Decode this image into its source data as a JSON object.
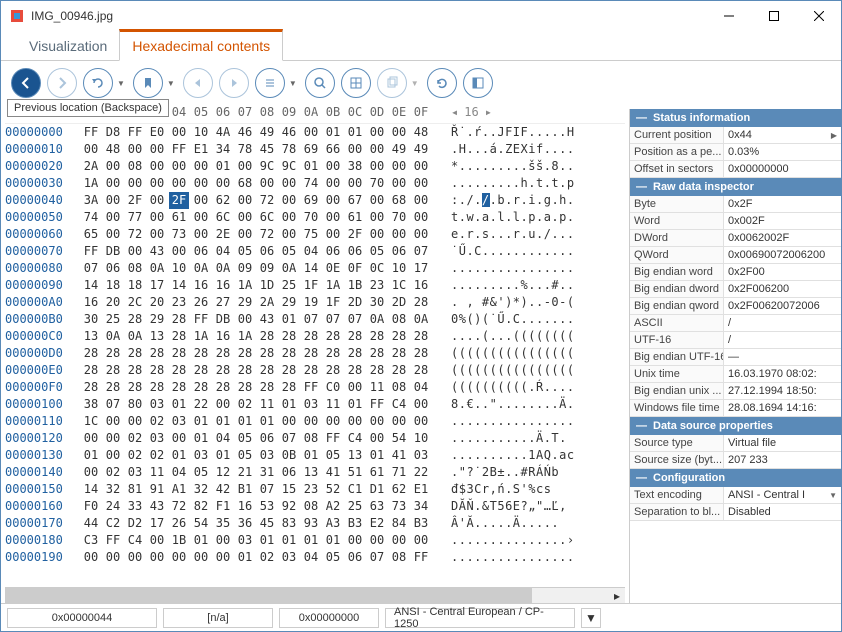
{
  "window": {
    "title": "IMG_00946.jpg"
  },
  "tabs": [
    {
      "label": "Visualization",
      "active": false
    },
    {
      "label": "Hexadecimal contents",
      "active": true
    }
  ],
  "toolbar": {
    "tooltip": "Previous location (Backspace)",
    "page_current": "16"
  },
  "hex": {
    "columns": [
      "00",
      "01",
      "02",
      "03",
      "04",
      "05",
      "06",
      "07",
      "08",
      "09",
      "0A",
      "0B",
      "0C",
      "0D",
      "0E",
      "0F"
    ],
    "highlight": {
      "row": 4,
      "col": 4
    },
    "rows": [
      {
        "offset": "00000000",
        "bytes": [
          "FF",
          "D8",
          "FF",
          "E0",
          "00",
          "10",
          "4A",
          "46",
          "49",
          "46",
          "00",
          "01",
          "01",
          "00",
          "00",
          "48"
        ],
        "ascii": "Ř˙.ŕ..JFIF.....H"
      },
      {
        "offset": "00000010",
        "bytes": [
          "00",
          "48",
          "00",
          "00",
          "FF",
          "E1",
          "34",
          "78",
          "45",
          "78",
          "69",
          "66",
          "00",
          "00",
          "49",
          "49"
        ],
        "ascii": ".H...á.ZEXif...."
      },
      {
        "offset": "00000020",
        "bytes": [
          "2A",
          "00",
          "08",
          "00",
          "00",
          "00",
          "01",
          "00",
          "9C",
          "9C",
          "01",
          "00",
          "38",
          "00",
          "00",
          "00"
        ],
        "ascii": "*.........šš.8.."
      },
      {
        "offset": "00000030",
        "bytes": [
          "1A",
          "00",
          "00",
          "00",
          "00",
          "00",
          "00",
          "68",
          "00",
          "00",
          "74",
          "00",
          "00",
          "70",
          "00",
          "00"
        ],
        "ascii": ".........h.t.t.p"
      },
      {
        "offset": "00000040",
        "bytes": [
          "3A",
          "00",
          "2F",
          "00",
          "2F",
          "00",
          "62",
          "00",
          "72",
          "00",
          "69",
          "00",
          "67",
          "00",
          "68",
          "00"
        ],
        "ascii": ":././.b.r.i.g.h."
      },
      {
        "offset": "00000050",
        "bytes": [
          "74",
          "00",
          "77",
          "00",
          "61",
          "00",
          "6C",
          "00",
          "6C",
          "00",
          "70",
          "00",
          "61",
          "00",
          "70",
          "00"
        ],
        "ascii": "t.w.a.l.l.p.a.p."
      },
      {
        "offset": "00000060",
        "bytes": [
          "65",
          "00",
          "72",
          "00",
          "73",
          "00",
          "2E",
          "00",
          "72",
          "00",
          "75",
          "00",
          "2F",
          "00",
          "00",
          "00"
        ],
        "ascii": "e.r.s...r.u./..."
      },
      {
        "offset": "00000070",
        "bytes": [
          "FF",
          "DB",
          "00",
          "43",
          "00",
          "06",
          "04",
          "05",
          "06",
          "05",
          "04",
          "06",
          "06",
          "05",
          "06",
          "07"
        ],
        "ascii": "˙Ű.C............"
      },
      {
        "offset": "00000080",
        "bytes": [
          "07",
          "06",
          "08",
          "0A",
          "10",
          "0A",
          "0A",
          "09",
          "09",
          "0A",
          "14",
          "0E",
          "0F",
          "0C",
          "10",
          "17"
        ],
        "ascii": "................"
      },
      {
        "offset": "00000090",
        "bytes": [
          "14",
          "18",
          "18",
          "17",
          "14",
          "16",
          "16",
          "1A",
          "1D",
          "25",
          "1F",
          "1A",
          "1B",
          "23",
          "1C",
          "16"
        ],
        "ascii": ".........%...#.."
      },
      {
        "offset": "000000A0",
        "bytes": [
          "16",
          "20",
          "2C",
          "20",
          "23",
          "26",
          "27",
          "29",
          "2A",
          "29",
          "19",
          "1F",
          "2D",
          "30",
          "2D",
          "28"
        ],
        "ascii": ". , #&')*)..-0-("
      },
      {
        "offset": "000000B0",
        "bytes": [
          "30",
          "25",
          "28",
          "29",
          "28",
          "FF",
          "DB",
          "00",
          "43",
          "01",
          "07",
          "07",
          "07",
          "0A",
          "08",
          "0A"
        ],
        "ascii": "0%()(˙Ű.C......."
      },
      {
        "offset": "000000C0",
        "bytes": [
          "13",
          "0A",
          "0A",
          "13",
          "28",
          "1A",
          "16",
          "1A",
          "28",
          "28",
          "28",
          "28",
          "28",
          "28",
          "28",
          "28"
        ],
        "ascii": "....(...(((((((("
      },
      {
        "offset": "000000D0",
        "bytes": [
          "28",
          "28",
          "28",
          "28",
          "28",
          "28",
          "28",
          "28",
          "28",
          "28",
          "28",
          "28",
          "28",
          "28",
          "28",
          "28"
        ],
        "ascii": "(((((((((((((((("
      },
      {
        "offset": "000000E0",
        "bytes": [
          "28",
          "28",
          "28",
          "28",
          "28",
          "28",
          "28",
          "28",
          "28",
          "28",
          "28",
          "28",
          "28",
          "28",
          "28",
          "28"
        ],
        "ascii": "(((((((((((((((("
      },
      {
        "offset": "000000F0",
        "bytes": [
          "28",
          "28",
          "28",
          "28",
          "28",
          "28",
          "28",
          "28",
          "28",
          "28",
          "FF",
          "C0",
          "00",
          "11",
          "08",
          "04"
        ],
        "ascii": "((((((((((.Ŕ...."
      },
      {
        "offset": "00000100",
        "bytes": [
          "38",
          "07",
          "80",
          "03",
          "01",
          "22",
          "00",
          "02",
          "11",
          "01",
          "03",
          "11",
          "01",
          "FF",
          "C4",
          "00"
        ],
        "ascii": "8.€..\"........Ä."
      },
      {
        "offset": "00000110",
        "bytes": [
          "1C",
          "00",
          "00",
          "02",
          "03",
          "01",
          "01",
          "01",
          "01",
          "00",
          "00",
          "00",
          "00",
          "00",
          "00",
          "00"
        ],
        "ascii": "................"
      },
      {
        "offset": "00000120",
        "bytes": [
          "00",
          "00",
          "02",
          "03",
          "00",
          "01",
          "04",
          "05",
          "06",
          "07",
          "08",
          "FF",
          "C4",
          "00",
          "54",
          "10"
        ],
        "ascii": "...........Ä.T."
      },
      {
        "offset": "00000130",
        "bytes": [
          "01",
          "00",
          "02",
          "02",
          "01",
          "03",
          "01",
          "05",
          "03",
          "0B",
          "01",
          "05",
          "13",
          "01",
          "41",
          "03"
        ],
        "ascii": "..........1AQ.ac"
      },
      {
        "offset": "00000140",
        "bytes": [
          "00",
          "02",
          "03",
          "11",
          "04",
          "05",
          "12",
          "21",
          "31",
          "06",
          "13",
          "41",
          "51",
          "61",
          "71",
          "22"
        ],
        "ascii": ".\"?˙2B±..#RÁŃb"
      },
      {
        "offset": "00000150",
        "bytes": [
          "14",
          "32",
          "81",
          "91",
          "A1",
          "32",
          "42",
          "B1",
          "07",
          "15",
          "23",
          "52",
          "C1",
          "D1",
          "62",
          "E1"
        ],
        "ascii": "đ$3Cr,ń.S'%cs"
      },
      {
        "offset": "00000160",
        "bytes": [
          "F0",
          "24",
          "33",
          "43",
          "72",
          "82",
          "F1",
          "16",
          "53",
          "92",
          "08",
          "A2",
          "25",
          "63",
          "73",
          "34"
        ],
        "ascii": "DĂŇ.&T56E?„\"…Ľ‚"
      },
      {
        "offset": "00000170",
        "bytes": [
          "44",
          "C2",
          "D2",
          "17",
          "26",
          "54",
          "35",
          "36",
          "45",
          "83",
          "93",
          "A3",
          "B3",
          "E2",
          "84",
          "B3"
        ],
        "ascii": "Â'Ă.....Ä..... "
      },
      {
        "offset": "00000180",
        "bytes": [
          "C3",
          "FF",
          "C4",
          "00",
          "1B",
          "01",
          "00",
          "03",
          "01",
          "01",
          "01",
          "01",
          "00",
          "00",
          "00",
          "00"
        ],
        "ascii": "...............›"
      },
      {
        "offset": "00000190",
        "bytes": [
          "00",
          "00",
          "00",
          "00",
          "00",
          "00",
          "00",
          "01",
          "02",
          "03",
          "04",
          "05",
          "06",
          "07",
          "08",
          "FF"
        ],
        "ascii": "................"
      }
    ]
  },
  "side": {
    "sections": [
      {
        "title": "Status information",
        "rows": [
          {
            "k": "Current position",
            "v": "0x44",
            "arrow": true
          },
          {
            "k": "Position as a pe...",
            "v": "0.03%"
          },
          {
            "k": "Offset in sectors",
            "v": "0x00000000"
          }
        ]
      },
      {
        "title": "Raw data inspector",
        "rows": [
          {
            "k": "Byte",
            "v": "0x2F"
          },
          {
            "k": "Word",
            "v": "0x002F"
          },
          {
            "k": "DWord",
            "v": "0x0062002F"
          },
          {
            "k": "QWord",
            "v": "0x00690072006200"
          },
          {
            "k": "Big endian word",
            "v": "0x2F00"
          },
          {
            "k": "Big endian dword",
            "v": "0x2F006200"
          },
          {
            "k": "Big endian qword",
            "v": "0x2F00620072006"
          },
          {
            "k": "ASCII",
            "v": "/"
          },
          {
            "k": "UTF-16",
            "v": "/"
          },
          {
            "k": "Big endian UTF-16",
            "v": "—"
          },
          {
            "k": "Unix time",
            "v": "16.03.1970 08:02:"
          },
          {
            "k": "Big endian unix ...",
            "v": "27.12.1994 18:50:"
          },
          {
            "k": "Windows file time",
            "v": "28.08.1694 14:16:"
          }
        ]
      },
      {
        "title": "Data source properties",
        "rows": [
          {
            "k": "Source type",
            "v": "Virtual file"
          },
          {
            "k": "Source size (byt...",
            "v": "207 233"
          }
        ]
      },
      {
        "title": "Configuration",
        "rows": [
          {
            "k": "Text encoding",
            "v": "ANSI - Central I",
            "dd": true
          },
          {
            "k": "Separation to bl...",
            "v": "Disabled"
          }
        ]
      }
    ]
  },
  "status": {
    "offset": "0x00000044",
    "na": "[n/a]",
    "sector": "0x00000000",
    "encoding": "ANSI - Central European / CP-1250"
  }
}
